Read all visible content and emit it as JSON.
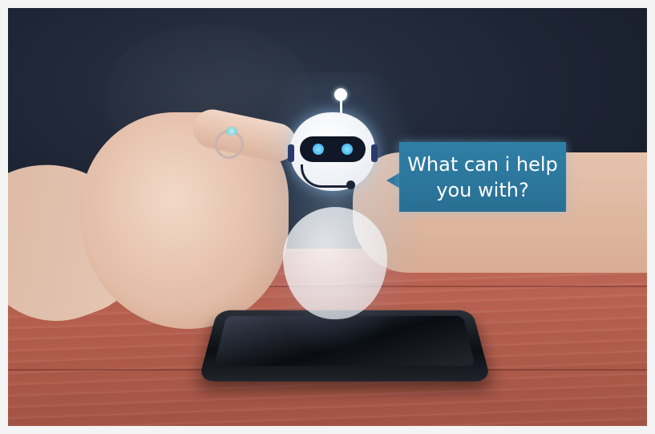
{
  "scene": {
    "bubble_text": "What can i help\nyou with?"
  },
  "colors": {
    "bubble": "#2d789f",
    "table": "#b7604f",
    "sweater": "#1d2433",
    "bot_eye": "#2aa6ea"
  },
  "icons": [
    "chatbot-robot-icon",
    "headset-mic-icon"
  ]
}
